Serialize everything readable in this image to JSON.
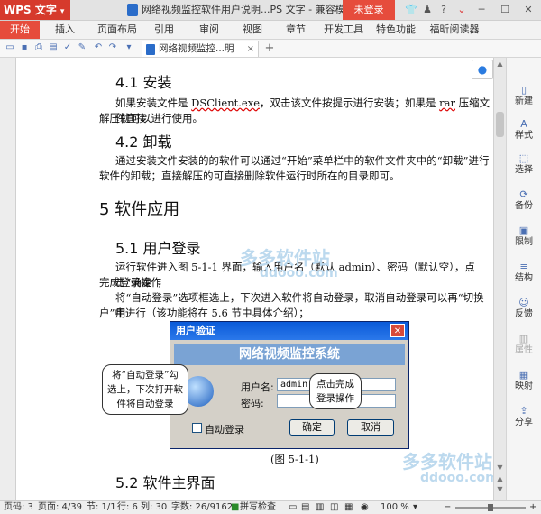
{
  "app": {
    "logo": "WPS 文字",
    "title": "网络视频监控软件用户说明...PS 文字 - 兼容模式",
    "login": "未登录"
  },
  "menu": [
    "开始",
    "插入",
    "页面布局",
    "引用",
    "审阅",
    "视图",
    "章节",
    "开发工具",
    "特色功能",
    "福昕阅读器"
  ],
  "doc_tab": {
    "name": "网络视频监控...明书.doc",
    "close": "×",
    "new": "+"
  },
  "content": {
    "h41": "4.1  安装",
    "p41_a": "如果安装文件是 ",
    "p41_file": "DSClient.exe",
    "p41_b": "，双击该文件按提示进行安装；如果是 ",
    "p41_rar": "rar",
    "p41_c": " 压缩文件直接",
    "p41_line2": "解压就可以进行使用。",
    "h42": "4.2  卸载",
    "p42_line1": "通过安装文件安装的的软件可以通过“开始”菜单栏中的软件文件夹中的“卸载”进行",
    "p42_line2": "软件的卸载；直接解压的可直接删除软件运行时所在的目录即可。",
    "h5": "5   软件应用",
    "h51": "5.1  用户登录",
    "p51_line1": "运行软件进入图 5-1-1 界面，输入用户名（默认 admin）、密码（默认空），点击“确定”，",
    "p51_line2": "完成登录操作",
    "p51_line3": "将“自动登录”选项框选上，下次进入软件将自动登录，取消自动登录可以再“切换用",
    "p51_line4": "户”中进行（该功能将在 5.6 节中具体介绍）；",
    "fig_caption": "(图 5-1-1)",
    "h52": "5.2  软件主界面"
  },
  "dialog": {
    "title": "用户验证",
    "banner": "网络视频监控系统",
    "user_label": "用户名:",
    "user_value": "admin",
    "pwd_label": "密码:",
    "auto_login": "自动登录",
    "ok": "确定",
    "cancel": "取消"
  },
  "callouts": {
    "left_1": "将“自动登录”勾",
    "left_2": "选上，下次打开软",
    "left_3": "件将自动登录",
    "right_1": "点击完成",
    "right_2": "登录操作"
  },
  "sidebar": [
    "新建",
    "样式",
    "选择",
    "备份",
    "限制",
    "结构",
    "反馈",
    "属性",
    "映射",
    "分享"
  ],
  "status": {
    "page_code": "页码: 3",
    "page": "页面: 4/39",
    "section": "节: 1/1",
    "row": "行: 6",
    "col": "列: 30",
    "words": "字数: 26/9162",
    "spell": "拼写检查",
    "zoom": "100 %"
  },
  "watermark": {
    "cn": "多多软件站",
    "en": "ddooo.com"
  }
}
